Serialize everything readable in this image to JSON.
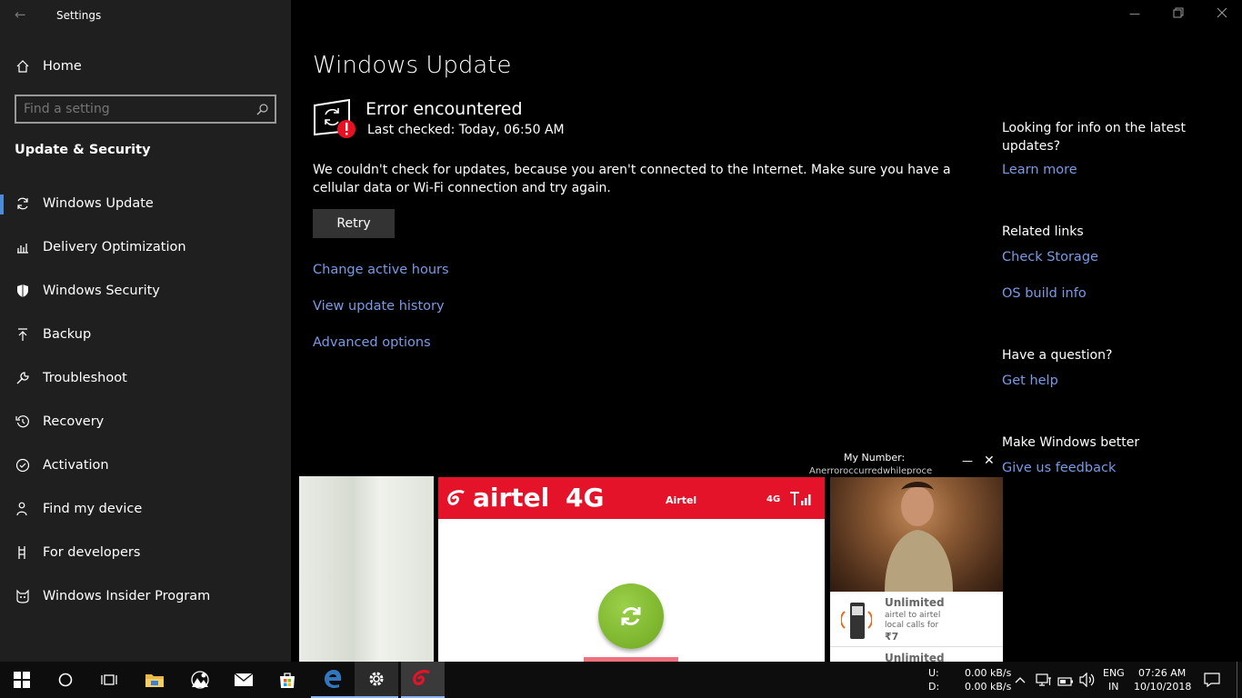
{
  "window": {
    "title": "Settings"
  },
  "sidebar": {
    "home": "Home",
    "search_placeholder": "Find a setting",
    "section": "Update & Security",
    "items": [
      {
        "label": "Windows Update",
        "icon": "refresh-icon"
      },
      {
        "label": "Delivery Optimization",
        "icon": "delivery-icon"
      },
      {
        "label": "Windows Security",
        "icon": "shield-icon"
      },
      {
        "label": "Backup",
        "icon": "backup-icon"
      },
      {
        "label": "Troubleshoot",
        "icon": "wrench-icon"
      },
      {
        "label": "Recovery",
        "icon": "recovery-icon"
      },
      {
        "label": "Activation",
        "icon": "check-circle-icon"
      },
      {
        "label": "Find my device",
        "icon": "person-location-icon"
      },
      {
        "label": "For developers",
        "icon": "developer-icon"
      },
      {
        "label": "Windows Insider Program",
        "icon": "insider-cat-icon"
      }
    ]
  },
  "main": {
    "page_title": "Windows Update",
    "status_title": "Error encountered",
    "last_checked": "Last checked: Today, 06:50 AM",
    "message": "We couldn't check for updates, because you aren't connected to the Internet. Make sure you have a cellular data or Wi-Fi connection and try again.",
    "retry": "Retry",
    "links": [
      "Change active hours",
      "View update history",
      "Advanced options"
    ]
  },
  "right_panel": {
    "info_heading": "Looking for info on the latest updates?",
    "learn_more": "Learn more",
    "related_heading": "Related links",
    "check_storage": "Check Storage",
    "os_build": "OS build info",
    "question_heading": "Have a question?",
    "get_help": "Get help",
    "better_heading": "Make Windows better",
    "feedback": "Give us feedback"
  },
  "airtel": {
    "my_number_label": "My Number:",
    "number_text": "Anerroroccurredwhileproce",
    "brand": "airtel",
    "brand_4g": "4G",
    "operator": "Airtel",
    "network": "4G",
    "ad_heading": "Unlimited",
    "ad_line1": "airtel to airtel",
    "ad_line2": "local calls for",
    "ad_price": "₹7",
    "ad_heading2": "Unlimited",
    "colors": {
      "red": "#e4132a",
      "green": "#7cb22a"
    }
  },
  "taskbar": {
    "upload_label": "U:",
    "download_label": "D:",
    "upload_speed": "0.00 kB/s",
    "download_speed": "0.00 kB/s",
    "lang1": "ENG",
    "lang2": "IN",
    "time": "07:26 AM",
    "date": "10/10/2018"
  }
}
